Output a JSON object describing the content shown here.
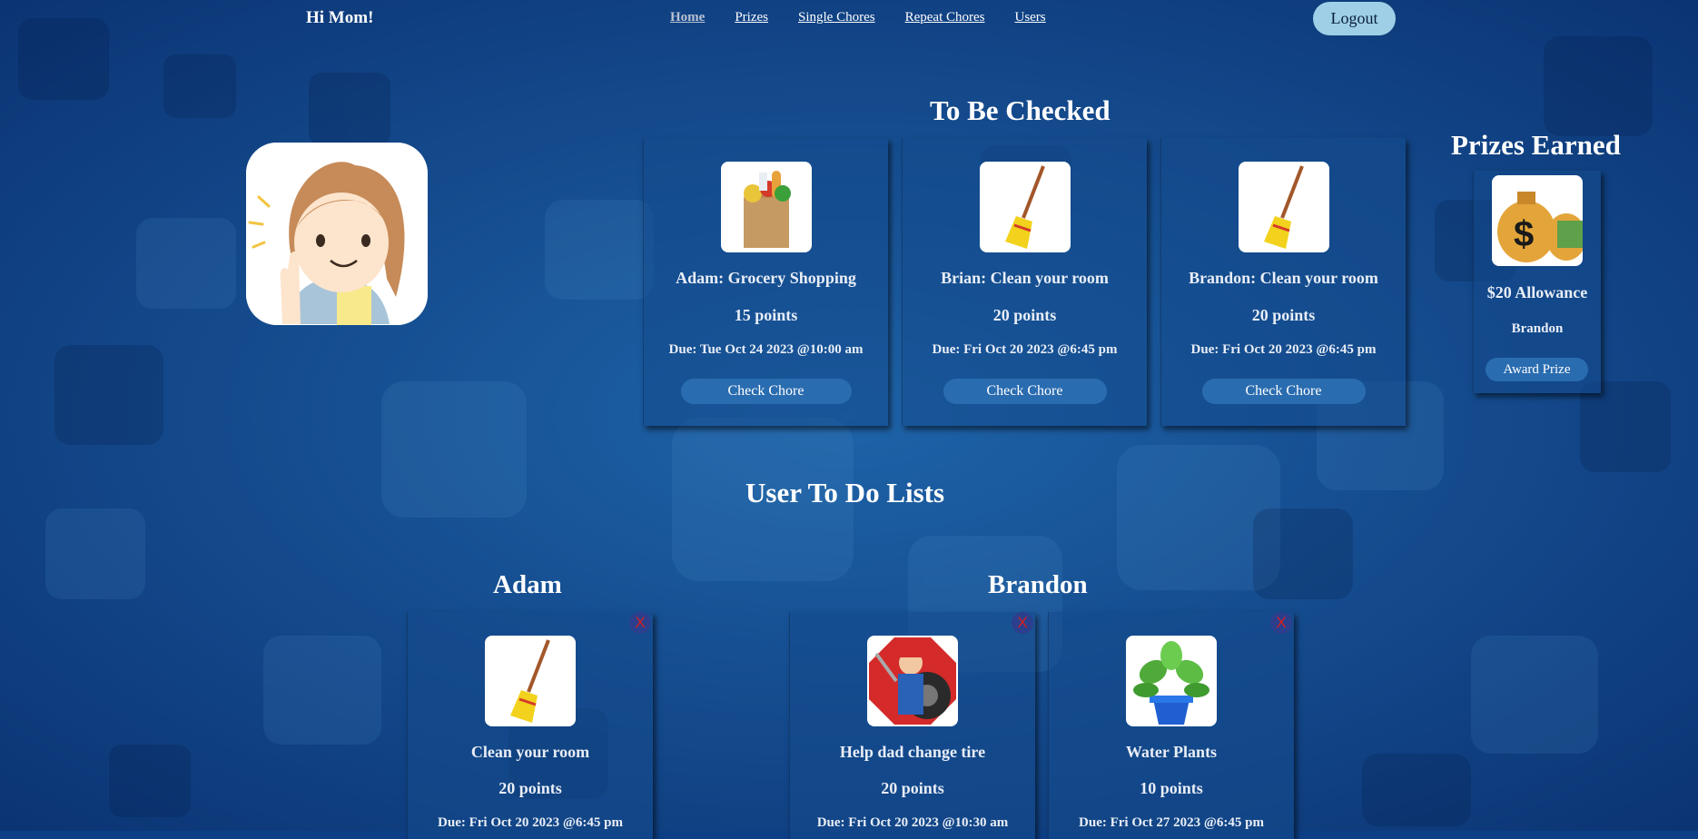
{
  "header": {
    "greeting": "Hi Mom!",
    "nav": [
      "Home",
      "Prizes",
      "Single Chores",
      "Repeat Chores",
      "Users"
    ],
    "logout": "Logout"
  },
  "to_be_checked": {
    "title": "To Be Checked",
    "cards": [
      {
        "icon": "grocery-bag-icon",
        "title": "Adam: Grocery Shopping",
        "points": "15 points",
        "due": "Due: Tue Oct 24 2023 @10:00 am",
        "button": "Check Chore"
      },
      {
        "icon": "broom-icon",
        "title": "Brian: Clean your room",
        "points": "20 points",
        "due": "Due: Fri Oct 20 2023 @6:45 pm",
        "button": "Check Chore"
      },
      {
        "icon": "broom-icon",
        "title": "Brandon: Clean your room",
        "points": "20 points",
        "due": "Due: Fri Oct 20 2023 @6:45 pm",
        "button": "Check Chore"
      }
    ]
  },
  "prizes": {
    "title": "Prizes Earned",
    "cards": [
      {
        "icon": "money-bag-icon",
        "title": "$20 Allowance",
        "user": "Brandon",
        "button": "Award Prize"
      }
    ]
  },
  "todo": {
    "title": "User To Do Lists",
    "users": [
      {
        "name": "Adam",
        "chores": [
          {
            "icon": "broom-icon",
            "title": "Clean your room",
            "points": "20 points",
            "due": "Due: Fri Oct 20 2023 @6:45 pm",
            "delete": "X"
          }
        ]
      },
      {
        "name": "Brandon",
        "chores": [
          {
            "icon": "mechanic-tire-icon",
            "title": "Help dad change tire",
            "points": "20 points",
            "due": "Due: Fri Oct 20 2023 @10:30 am",
            "delete": "X"
          },
          {
            "icon": "potted-plant-icon",
            "title": "Water Plants",
            "points": "10 points",
            "due": "Due: Fri Oct 27 2023 @6:45 pm",
            "delete": "X"
          }
        ]
      }
    ]
  },
  "colors": {
    "background": "#0d3f86",
    "button": "#2a6cb0",
    "logout": "#9ecfe6",
    "delete_x": "#d42020"
  }
}
